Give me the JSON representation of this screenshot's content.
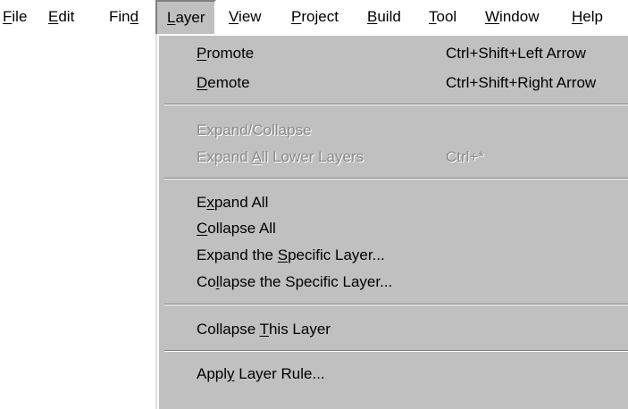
{
  "menubar": {
    "items": [
      {
        "label": "File",
        "parts": [
          "",
          "F",
          "ile"
        ]
      },
      {
        "label": "Edit",
        "parts": [
          "",
          "E",
          "dit"
        ]
      },
      {
        "label": "Find",
        "parts": [
          "Fin",
          "d",
          ""
        ]
      },
      {
        "label": "Layer",
        "parts": [
          "",
          "L",
          "ayer"
        ]
      },
      {
        "label": "View",
        "parts": [
          "",
          "V",
          "iew"
        ]
      },
      {
        "label": "Project",
        "parts": [
          "",
          "P",
          "roject"
        ]
      },
      {
        "label": "Build",
        "parts": [
          "",
          "B",
          "uild"
        ]
      },
      {
        "label": "Tool",
        "parts": [
          "",
          "T",
          "ool"
        ]
      },
      {
        "label": "Window",
        "parts": [
          "",
          "W",
          "indow"
        ]
      },
      {
        "label": "Help",
        "parts": [
          "",
          "H",
          "elp"
        ]
      }
    ]
  },
  "layer_menu": {
    "groups": [
      [
        {
          "label": "Promote",
          "parts": [
            "",
            "P",
            "romote"
          ],
          "shortcut": "Ctrl+Shift+Left Arrow",
          "enabled": true
        },
        {
          "label": "Demote",
          "parts": [
            "",
            "D",
            "emote"
          ],
          "shortcut": "Ctrl+Shift+Right Arrow",
          "enabled": true
        }
      ],
      [
        {
          "label": "Expand/Collapse",
          "parts": [
            "Expand/Collapse",
            "",
            ""
          ],
          "shortcut": "",
          "enabled": false
        },
        {
          "label": "Expand All Lower Layers",
          "parts": [
            "Expand ",
            "A",
            "ll Lower Layers"
          ],
          "shortcut": "Ctrl+*",
          "enabled": false
        }
      ],
      [
        {
          "label": "Expand All",
          "parts": [
            "E",
            "x",
            "pand All"
          ],
          "shortcut": "",
          "enabled": true
        },
        {
          "label": "Collapse All",
          "parts": [
            "",
            "C",
            "ollapse All"
          ],
          "shortcut": "",
          "enabled": true
        },
        {
          "label": "Expand the Specific Layer...",
          "parts": [
            "Expand the ",
            "S",
            "pecific Layer..."
          ],
          "shortcut": "",
          "enabled": true
        },
        {
          "label": "Collapse the Specific Layer...",
          "parts": [
            "Co",
            "l",
            "lapse the Specific Layer..."
          ],
          "shortcut": "",
          "enabled": true
        }
      ],
      [
        {
          "label": "Collapse This Layer",
          "parts": [
            "Collapse ",
            "T",
            "his Layer"
          ],
          "shortcut": "",
          "enabled": true
        }
      ],
      [
        {
          "label": "Apply Layer Rule...",
          "parts": [
            "Appl",
            "y",
            " Layer Rule..."
          ],
          "shortcut": "",
          "enabled": true
        }
      ]
    ]
  }
}
